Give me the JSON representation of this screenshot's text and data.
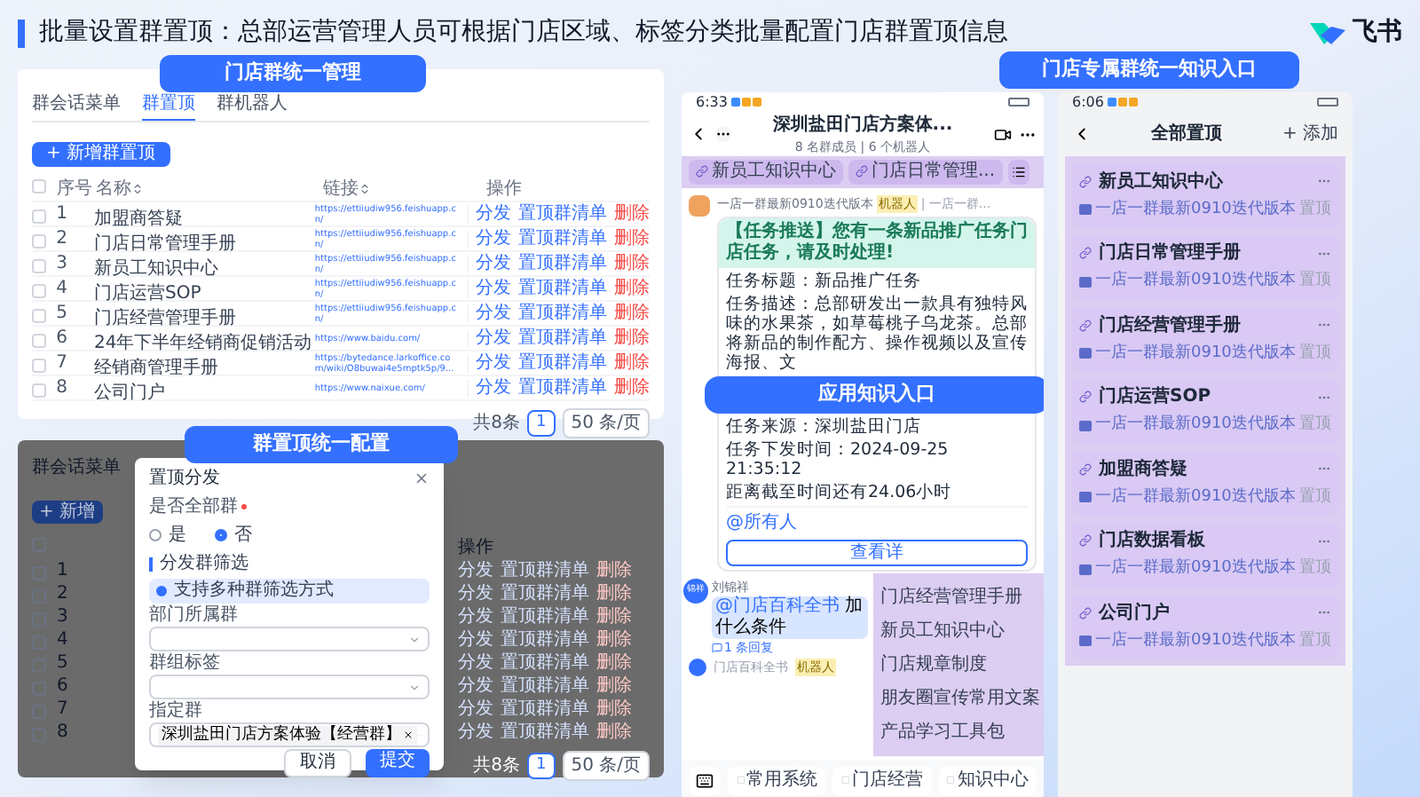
{
  "title": "批量设置群置顶：总部运营管理人员可根据门店区域、标签分类批量配置门店群置顶信息",
  "brand": {
    "name": "飞书"
  },
  "admin_panel": {
    "label": "门店群统一管理",
    "tabs": [
      {
        "label": "群会话菜单",
        "selected": false
      },
      {
        "label": "群置顶",
        "selected": true
      },
      {
        "label": "群机器人",
        "selected": false
      }
    ],
    "add_button": "+ 新增群置顶",
    "all_checked": false,
    "columns": [
      "序号",
      "名称",
      "链接",
      "操作"
    ],
    "rows": [
      {
        "checked": false,
        "index": "1",
        "name": "加盟商答疑",
        "link": "https://ettiiudiw956.feishuapp.cn/",
        "actions": [
          {
            "label": "分发",
            "danger": false
          },
          {
            "label": "置顶群清单",
            "danger": false
          },
          {
            "label": "删除",
            "danger": true
          }
        ]
      },
      {
        "checked": false,
        "index": "2",
        "name": "门店日常管理手册",
        "link": "https://ettiiudiw956.feishuapp.cn/",
        "actions": [
          {
            "label": "分发",
            "danger": false
          },
          {
            "label": "置顶群清单",
            "danger": false
          },
          {
            "label": "删除",
            "danger": true
          }
        ]
      },
      {
        "checked": false,
        "index": "3",
        "name": "新员工知识中心",
        "link": "https://ettiiudiw956.feishuapp.cn/",
        "actions": [
          {
            "label": "分发",
            "danger": false
          },
          {
            "label": "置顶群清单",
            "danger": false
          },
          {
            "label": "删除",
            "danger": true
          }
        ]
      },
      {
        "checked": false,
        "index": "4",
        "name": "门店运营SOP",
        "link": "https://ettiiudiw956.feishuapp.cn/",
        "actions": [
          {
            "label": "分发",
            "danger": false
          },
          {
            "label": "置顶群清单",
            "danger": false
          },
          {
            "label": "删除",
            "danger": true
          }
        ]
      },
      {
        "checked": false,
        "index": "5",
        "name": "门店经营管理手册",
        "link": "https://ettiiudiw956.feishuapp.cn/",
        "actions": [
          {
            "label": "分发",
            "danger": false
          },
          {
            "label": "置顶群清单",
            "danger": false
          },
          {
            "label": "删除",
            "danger": true
          }
        ]
      },
      {
        "checked": false,
        "index": "6",
        "name": "24年下半年经销商促销活动",
        "link": "https://www.baidu.com/",
        "actions": [
          {
            "label": "分发",
            "danger": false
          },
          {
            "label": "置顶群清单",
            "danger": false
          },
          {
            "label": "删除",
            "danger": true
          }
        ]
      },
      {
        "checked": false,
        "index": "7",
        "name": "经销商管理手册",
        "link": "https://bytedance.larkoffice.com/wiki/O8buwai4e5mptk5p/9...",
        "actions": [
          {
            "label": "分发",
            "danger": false
          },
          {
            "label": "置顶群清单",
            "danger": false
          },
          {
            "label": "删除",
            "danger": true
          }
        ]
      },
      {
        "checked": false,
        "index": "8",
        "name": "公司门户",
        "link": "https://www.naixue.com/",
        "actions": [
          {
            "label": "分发",
            "danger": false
          },
          {
            "label": "置顶群清单",
            "danger": false
          },
          {
            "label": "删除",
            "danger": true
          }
        ]
      }
    ],
    "pagination": {
      "total": "共8条",
      "page": "1",
      "size": "50 条/页"
    }
  },
  "config_panel": {
    "label": "群置顶统一配置",
    "tab": "群会话菜单",
    "add_button": "+ 新增",
    "column": "操作",
    "rows": [
      {
        "index": "1",
        "actions": [
          {
            "label": "分发",
            "danger": false
          },
          {
            "label": "置顶群清单",
            "danger": false
          },
          {
            "label": "删除",
            "danger": true
          }
        ]
      },
      {
        "index": "2",
        "actions": [
          {
            "label": "分发",
            "danger": false
          },
          {
            "label": "置顶群清单",
            "danger": false
          },
          {
            "label": "删除",
            "danger": true
          }
        ]
      },
      {
        "index": "3",
        "actions": [
          {
            "label": "分发",
            "danger": false
          },
          {
            "label": "置顶群清单",
            "danger": false
          },
          {
            "label": "删除",
            "danger": true
          }
        ]
      },
      {
        "index": "4",
        "actions": [
          {
            "label": "分发",
            "danger": false
          },
          {
            "label": "置顶群清单",
            "danger": false
          },
          {
            "label": "删除",
            "danger": true
          }
        ]
      },
      {
        "index": "5",
        "actions": [
          {
            "label": "分发",
            "danger": false
          },
          {
            "label": "置顶群清单",
            "danger": false
          },
          {
            "label": "删除",
            "danger": true
          }
        ]
      },
      {
        "index": "6",
        "actions": [
          {
            "label": "分发",
            "danger": false
          },
          {
            "label": "置顶群清单",
            "danger": false
          },
          {
            "label": "删除",
            "danger": true
          }
        ]
      },
      {
        "index": "7",
        "actions": [
          {
            "label": "分发",
            "danger": false
          },
          {
            "label": "置顶群清单",
            "danger": false
          },
          {
            "label": "删除",
            "danger": true
          }
        ]
      },
      {
        "index": "8",
        "actions": [
          {
            "label": "分发",
            "danger": false
          },
          {
            "label": "置顶群清单",
            "danger": false
          },
          {
            "label": "删除",
            "danger": true
          }
        ]
      }
    ],
    "pagination": {
      "total": "共8条",
      "page": "1",
      "size": "50 条/页"
    },
    "modal": {
      "title": "置顶分发",
      "question": "是否全部群",
      "required": true,
      "radios": [
        {
          "label": "是",
          "selected": false
        },
        {
          "label": "否",
          "selected": true
        }
      ],
      "section": "分发群筛选",
      "notice": "支持多种群筛选方式",
      "fields": [
        {
          "label": "部门所属群"
        },
        {
          "label": "群组标签"
        },
        {
          "label": "指定群",
          "tags": [
            "深圳盐田门店方案体验【经营群】"
          ]
        }
      ],
      "cancel": "取消",
      "submit": "提交"
    }
  },
  "chat_phone": {
    "label": "门店专属群统一知识入口",
    "time": "6:33",
    "group_name": "深圳盐田门店方案体...",
    "members": "8 名群成员 | 6 个机器人",
    "pins": [
      "新员工知识中心",
      "门店日常管理..."
    ],
    "bot_sender": "一店一群最新0910迭代版本",
    "bot_badge": "机器人",
    "bot_extra": "| 一店一群...",
    "card": {
      "header": "【任务推送】您有一条新品推广任务门店任务，请及时处理!",
      "lines": [
        "任务标题：新品推广任务",
        "任务描述：总部研发出一款具有独特风味的水果茶，如草莓桃子乌龙茶。总部将新品的制作配方、操作视频以及宣传海报、文",
        "任务来源：深圳盐田门店",
        "任务下发时间：2024-09-25 21:35:12",
        "距离截至时间还有24.06小时"
      ],
      "mention": "@所有人",
      "button": "查看详"
    },
    "overlay_label": "应用知识入口",
    "user": {
      "avatar": "锦祥",
      "name": "刘锦祥",
      "mention": "@门店百科全书",
      "text": "加",
      "text2": "什么条件",
      "replies": "1 条回复"
    },
    "next_sender": "门店百科全书",
    "next_badge": "机器人",
    "menu": [
      "门店经营管理手册",
      "新员工知识中心",
      "门店规章制度",
      "朋友圈宣传常用文案",
      "产品学习工具包"
    ],
    "bottom_tabs": [
      "常用系统",
      "门店经营",
      "知识中心"
    ]
  },
  "pins_phone": {
    "time": "6:06",
    "title": "全部置顶",
    "add": "+ 添加",
    "items": [
      {
        "name": "新员工知识中心",
        "source": "一店一群最新0910迭代版本",
        "tag": "置顶"
      },
      {
        "name": "门店日常管理手册",
        "source": "一店一群最新0910迭代版本",
        "tag": "置顶"
      },
      {
        "name": "门店经营管理手册",
        "source": "一店一群最新0910迭代版本",
        "tag": "置顶"
      },
      {
        "name": "门店运营SOP",
        "source": "一店一群最新0910迭代版本",
        "tag": "置顶"
      },
      {
        "name": "加盟商答疑",
        "source": "一店一群最新0910迭代版本",
        "tag": "置顶"
      },
      {
        "name": "门店数据看板",
        "source": "一店一群最新0910迭代版本",
        "tag": "置顶"
      },
      {
        "name": "公司门户",
        "source": "一店一群最新0910迭代版本",
        "tag": "置顶"
      }
    ]
  }
}
